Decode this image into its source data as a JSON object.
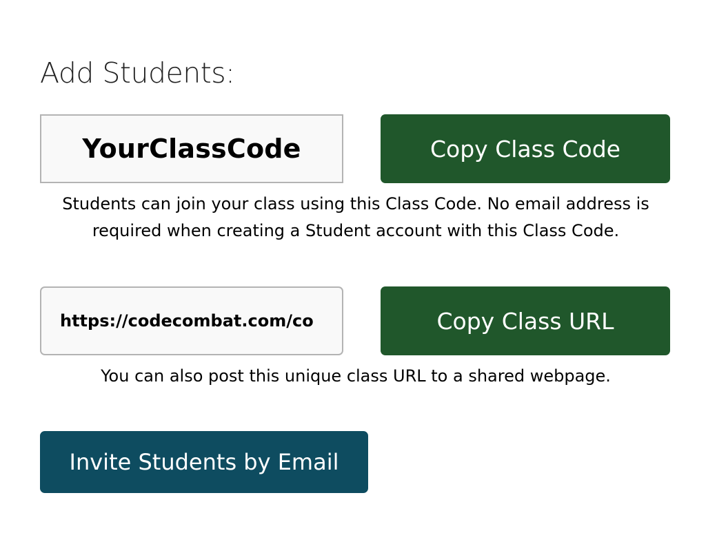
{
  "heading": "Add Students:",
  "class_code": {
    "value": "YourClassCode",
    "copy_button_label": "Copy Class Code",
    "help_text": "Students can join your class using this Class Code. No email address is required when creating a Student account with this Class Code."
  },
  "class_url": {
    "value": "https://codecombat.com/co",
    "copy_button_label": "Copy Class URL",
    "help_text": "You can also post this unique class URL to a shared webpage."
  },
  "invite": {
    "button_label": "Invite Students by Email"
  },
  "colors": {
    "copy_button_bg": "#20572b",
    "invite_button_bg": "#0e4c60",
    "box_border": "#b3b3b3",
    "box_bg": "#f9f9f9"
  }
}
